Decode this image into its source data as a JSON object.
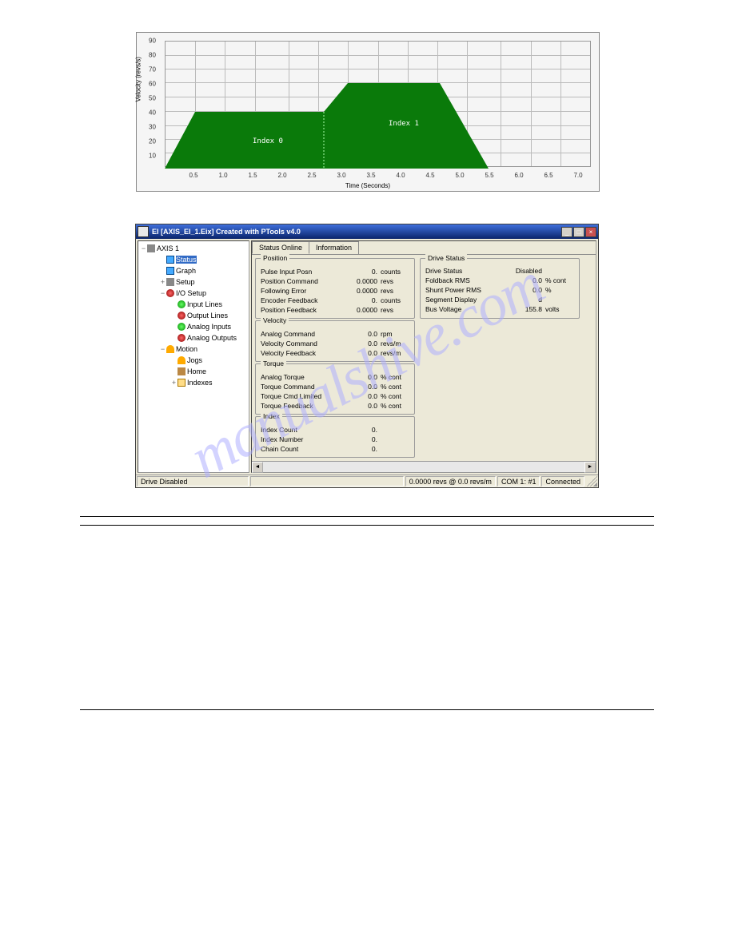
{
  "chart_data": {
    "type": "area",
    "xlabel": "Time (Seconds)",
    "ylabel": "Velocity (revs/s)",
    "xlim": [
      0,
      7.0
    ],
    "ylim": [
      0,
      90
    ],
    "y_ticks": [
      0,
      10,
      20,
      30,
      40,
      50,
      60,
      70,
      80,
      90
    ],
    "x_ticks": [
      0.5,
      1.0,
      1.5,
      2.0,
      2.5,
      3.0,
      3.5,
      4.0,
      4.5,
      5.0,
      5.5,
      6.0,
      6.5,
      7.0
    ],
    "series": [
      {
        "name": "Index 0",
        "points": [
          [
            0.0,
            0
          ],
          [
            0.5,
            40
          ],
          [
            2.6,
            40
          ],
          [
            2.6,
            0
          ]
        ]
      },
      {
        "name": "Index 1",
        "points": [
          [
            2.6,
            0
          ],
          [
            2.6,
            40
          ],
          [
            3.0,
            60
          ],
          [
            4.5,
            60
          ],
          [
            5.3,
            0
          ]
        ]
      }
    ],
    "annotations": [
      {
        "text": "Index 0",
        "x": 1.6,
        "y": 20
      },
      {
        "text": "Index 1",
        "x": 3.9,
        "y": 33
      }
    ]
  },
  "window": {
    "title": "EI  [AXIS_EI_1.Eix] Created with PTools v4.0",
    "min_btn": "_",
    "max_btn": "□",
    "close_btn": "×"
  },
  "tree": {
    "root": "AXIS 1",
    "items": [
      {
        "icon": "ic-blue",
        "label": "Status",
        "indent": 1,
        "selected": true
      },
      {
        "icon": "ic-blue",
        "label": "Graph",
        "indent": 1
      },
      {
        "icon": "ic-pc",
        "label": "Setup",
        "indent": 1,
        "toggle": "+"
      },
      {
        "icon": "ic-red",
        "label": "I/O Setup",
        "indent": 1,
        "toggle": "−"
      },
      {
        "icon": "ic-green",
        "label": "Input Lines",
        "indent": 2
      },
      {
        "icon": "ic-red",
        "label": "Output Lines",
        "indent": 2
      },
      {
        "icon": "ic-green",
        "label": "Analog Inputs",
        "indent": 2
      },
      {
        "icon": "ic-red",
        "label": "Analog Outputs",
        "indent": 2
      },
      {
        "icon": "ic-person",
        "label": "Motion",
        "indent": 1,
        "toggle": "−"
      },
      {
        "icon": "ic-person",
        "label": "Jogs",
        "indent": 2
      },
      {
        "icon": "ic-house",
        "label": "Home",
        "indent": 2
      },
      {
        "icon": "ic-folder",
        "label": "Indexes",
        "indent": 2,
        "toggle": "+"
      }
    ]
  },
  "tabs": {
    "status": "Status Online",
    "info": "Information"
  },
  "groups": {
    "position": {
      "title": "Position",
      "rows": [
        {
          "lbl": "Pulse Input Posn",
          "val": "0.",
          "unit": "counts"
        },
        {
          "lbl": "Position Command",
          "val": "0.0000",
          "unit": "revs"
        },
        {
          "lbl": "Following Error",
          "val": "0.0000",
          "unit": "revs"
        },
        {
          "lbl": "Encoder Feedback",
          "val": "0.",
          "unit": "counts"
        },
        {
          "lbl": "Position Feedback",
          "val": "0.0000",
          "unit": "revs"
        }
      ]
    },
    "velocity": {
      "title": "Velocity",
      "rows": [
        {
          "lbl": "Analog Command",
          "val": "0.0",
          "unit": "rpm"
        },
        {
          "lbl": "Velocity Command",
          "val": "0.0",
          "unit": "revs/m"
        },
        {
          "lbl": "Velocity Feedback",
          "val": "0.0",
          "unit": "revs/m"
        }
      ]
    },
    "torque": {
      "title": "Torque",
      "rows": [
        {
          "lbl": "Analog Torque",
          "val": "0.0",
          "unit": "% cont"
        },
        {
          "lbl": "Torque Command",
          "val": "0.0",
          "unit": "% cont"
        },
        {
          "lbl": "Torque Cmd Limited",
          "val": "0.0",
          "unit": "% cont"
        },
        {
          "lbl": "Torque Feedback",
          "val": "0.0",
          "unit": "% cont"
        }
      ]
    },
    "index": {
      "title": "Index",
      "rows": [
        {
          "lbl": "Index Count",
          "val": "0.",
          "unit": ""
        },
        {
          "lbl": "Index Number",
          "val": "0.",
          "unit": ""
        },
        {
          "lbl": "Chain Count",
          "val": "0.",
          "unit": ""
        }
      ]
    },
    "drive_status": {
      "title": "Drive Status",
      "rows": [
        {
          "lbl": "Drive Status",
          "val": "Disabled",
          "unit": ""
        },
        {
          "lbl": "Foldback RMS",
          "val": "0.0",
          "unit": "% cont"
        },
        {
          "lbl": "Shunt Power RMS",
          "val": "0.0",
          "unit": "%"
        },
        {
          "lbl": "Segment Display",
          "val": "d",
          "unit": ""
        },
        {
          "lbl": "Bus Voltage",
          "val": "155.8",
          "unit": "volts"
        }
      ]
    }
  },
  "statusbar": {
    "left": "Drive Disabled",
    "mid": "0.0000 revs @ 0.0 revs/m",
    "com": "COM 1: #1",
    "conn": "Connected"
  },
  "watermark": "manualshive.com"
}
